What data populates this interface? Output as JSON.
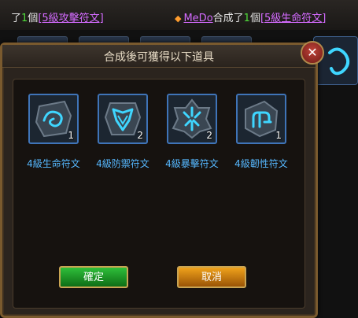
{
  "chat": {
    "left": {
      "prefix": "了",
      "count": "1",
      "unit": "個",
      "item": "[5級攻擊符文]"
    },
    "right": {
      "player": "MeDo",
      "verb": "合成了",
      "count": "1",
      "unit": "個",
      "item": "[5級生命符文]"
    }
  },
  "dialog": {
    "title": "合成後可獲得以下道具",
    "close_symbol": "✕",
    "items": [
      {
        "label": "4級生命符文",
        "count": "1",
        "icon": "life-rune-icon"
      },
      {
        "label": "4級防禦符文",
        "count": "2",
        "icon": "defense-rune-icon"
      },
      {
        "label": "4級暴擊符文",
        "count": "2",
        "icon": "crit-rune-icon"
      },
      {
        "label": "4級韌性符文",
        "count": "1",
        "icon": "toughness-rune-icon"
      }
    ],
    "confirm_label": "確定",
    "cancel_label": "取消"
  },
  "colors": {
    "rune_glow": "#3fd6ff",
    "item_label": "#56b8ff",
    "frame_gold": "#7a5a2e"
  }
}
